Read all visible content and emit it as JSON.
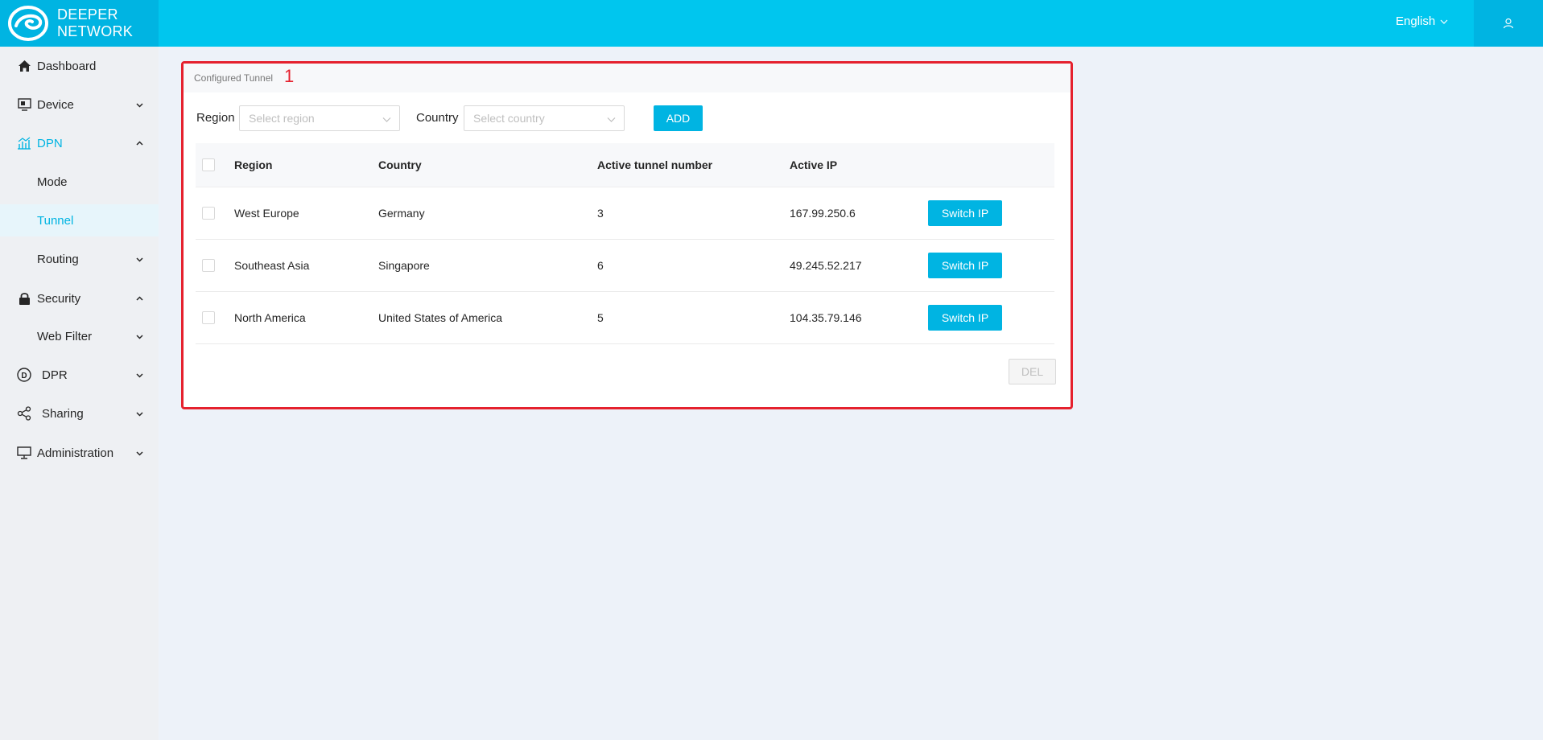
{
  "brand": {
    "line1": "DEEPER",
    "line2": "NETWORK"
  },
  "header": {
    "language": "English"
  },
  "sidebar": {
    "items": [
      {
        "label": "Dashboard",
        "icon": "home-icon"
      },
      {
        "label": "Device",
        "icon": "monitor-icon"
      },
      {
        "label": "DPN",
        "icon": "chart-icon"
      },
      {
        "label": "Mode"
      },
      {
        "label": "Tunnel"
      },
      {
        "label": "Routing"
      },
      {
        "label": "Security",
        "icon": "lock-icon"
      },
      {
        "label": "Web Filter"
      },
      {
        "label": "DPR",
        "icon": "dpr-coin-icon"
      },
      {
        "label": "Sharing",
        "icon": "share-icon"
      },
      {
        "label": "Administration",
        "icon": "desktop-icon"
      }
    ]
  },
  "panel": {
    "title": "Configured Tunnel",
    "annotation_number": "1",
    "filters": {
      "region_label": "Region",
      "region_placeholder": "Select region",
      "country_label": "Country",
      "country_placeholder": "Select country",
      "add_label": "ADD"
    },
    "table": {
      "headers": {
        "region": "Region",
        "country": "Country",
        "active_tunnel_number": "Active tunnel number",
        "active_ip": "Active IP"
      },
      "rows": [
        {
          "region": "West Europe",
          "country": "Germany",
          "active_tunnel_number": "3",
          "active_ip": "167.99.250.6",
          "action": "Switch IP"
        },
        {
          "region": "Southeast Asia",
          "country": "Singapore",
          "active_tunnel_number": "6",
          "active_ip": "49.245.52.217",
          "action": "Switch IP"
        },
        {
          "region": "North America",
          "country": "United States of America",
          "active_tunnel_number": "5",
          "active_ip": "104.35.79.146",
          "action": "Switch IP"
        }
      ]
    },
    "del_label": "DEL"
  },
  "colors": {
    "accent": "#00b4e2",
    "topbar": "#00c6ee",
    "highlight_border": "#e5212e"
  }
}
